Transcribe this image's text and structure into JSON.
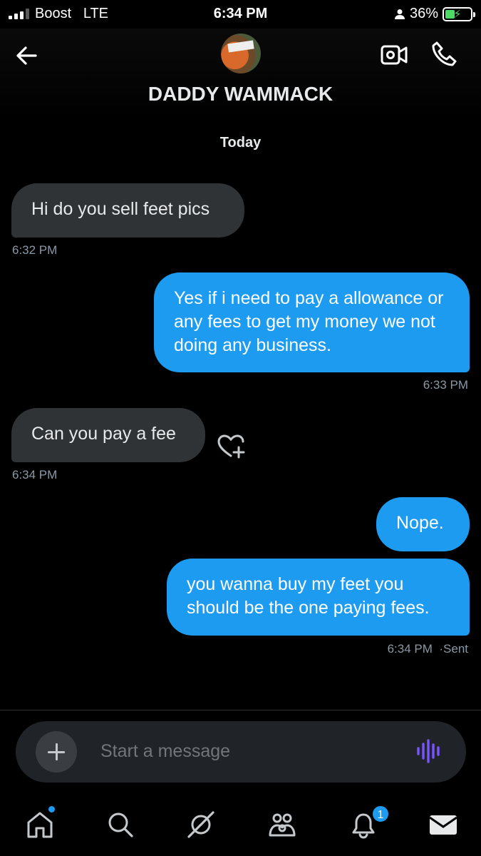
{
  "status_bar": {
    "carrier": "Boost",
    "network": "LTE",
    "time": "6:34 PM",
    "battery": "36%",
    "battery_level": 0.36,
    "signal_bars": 3
  },
  "header": {
    "contact_name": "DADDY WAMMACK",
    "back_icon": "arrow-left-icon",
    "video_icon": "video-camera-icon",
    "call_icon": "phone-icon"
  },
  "conversation": {
    "day_separator": "Today",
    "messages": [
      {
        "direction": "incoming",
        "text": "Hi do you sell feet pics",
        "time": "6:32 PM"
      },
      {
        "direction": "outgoing",
        "text": "Yes if i need to pay a allowance or any fees to get my money we not doing any business.",
        "time": "6:33 PM"
      },
      {
        "direction": "incoming",
        "text": "Can you pay a fee",
        "time": "6:34 PM"
      },
      {
        "direction": "outgoing",
        "text": "Nope.",
        "time": ""
      },
      {
        "direction": "outgoing",
        "text": "you wanna buy my feet you should be the one paying fees.",
        "time": "6:34 PM",
        "status": "·Sent"
      }
    ]
  },
  "composer": {
    "placeholder": "Start a message"
  },
  "bottom_nav": {
    "items": [
      "home-icon",
      "search-icon",
      "communities-icon",
      "people-icon",
      "notifications-icon",
      "messages-icon"
    ],
    "notifications_badge": "1"
  },
  "colors": {
    "accent": "#1d9bf0",
    "incoming_bubble": "#2f3336",
    "battery": "#4cd964",
    "voice_icon": "#7856ff"
  }
}
